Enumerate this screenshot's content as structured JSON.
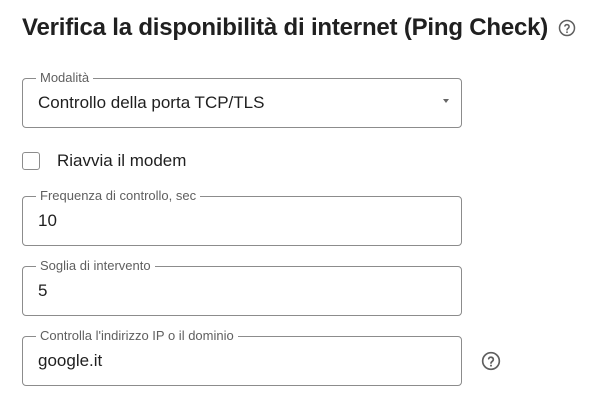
{
  "header": {
    "title": "Verifica la disponibilità di internet (Ping Check)",
    "help_icon": "help-circle-icon"
  },
  "mode": {
    "label": "Modalità",
    "value": "Controllo della porta TCP/TLS",
    "icon": "dropdown-arrow-icon"
  },
  "restart_modem": {
    "label": "Riavvia il modem",
    "checked": false
  },
  "check_frequency": {
    "label": "Frequenza di controllo, sec",
    "value": "10"
  },
  "threshold": {
    "label": "Soglia di intervento",
    "value": "5"
  },
  "target": {
    "label": "Controlla l'indirizzo IP o il dominio",
    "value": "google.it",
    "help_icon": "help-circle-icon"
  },
  "colors": {
    "border": "#8c8c8c",
    "text": "#1f1f1f",
    "label": "#5f5f5f",
    "icon": "#5f5f5f"
  }
}
